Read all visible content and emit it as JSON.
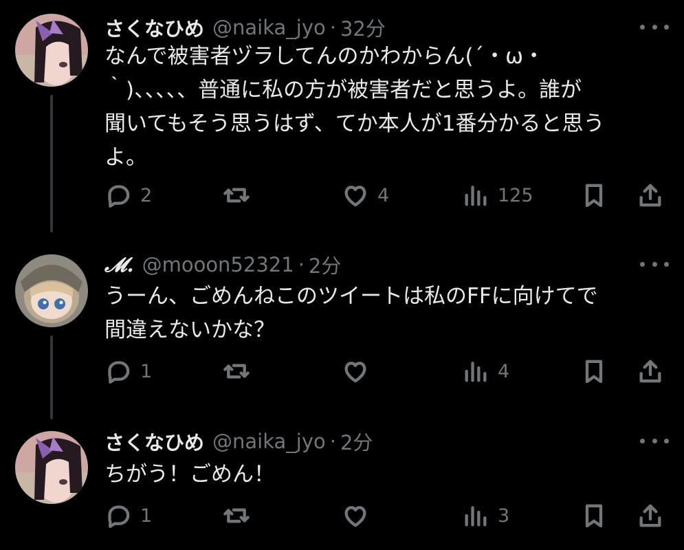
{
  "tweets": [
    {
      "name": "さくなひめ",
      "handle": "@naika_jyo",
      "separator": "·",
      "time": "32分",
      "lines": [
        "なんで被害者ヅラしてんのかわからん(´・ω・",
        "｀)、、、、、普通に私の方が被害者だと思うよ。誰が",
        "聞いてもそう思うはず、てか本人が1番分かると思う",
        "よ。"
      ],
      "reply_count": "2",
      "retweet_count": "",
      "like_count": "4",
      "view_count": "125"
    },
    {
      "name": "𝓜.",
      "handle": "@mooon52321",
      "separator": "·",
      "time": "2分",
      "lines": [
        "うーん、ごめんねこのツイートは私のFFに向けてで",
        "間違えないかな？"
      ],
      "reply_count": "1",
      "retweet_count": "",
      "like_count": "",
      "view_count": "4"
    },
    {
      "name": "さくなひめ",
      "handle": "@naika_jyo",
      "separator": "·",
      "time": "2分",
      "lines": [
        "ちがう！ごめん！"
      ],
      "reply_count": "1",
      "retweet_count": "",
      "like_count": "",
      "view_count": "3"
    }
  ],
  "icons": {
    "reply": "reply-icon",
    "retweet": "retweet-icon",
    "like": "like-icon",
    "views": "views-icon",
    "bookmark": "bookmark-icon",
    "share": "share-icon",
    "more": "more-icon"
  },
  "colors": {
    "background": "#000000",
    "text": "#e7e9ea",
    "muted": "#71767b",
    "thread_line": "#333639"
  }
}
